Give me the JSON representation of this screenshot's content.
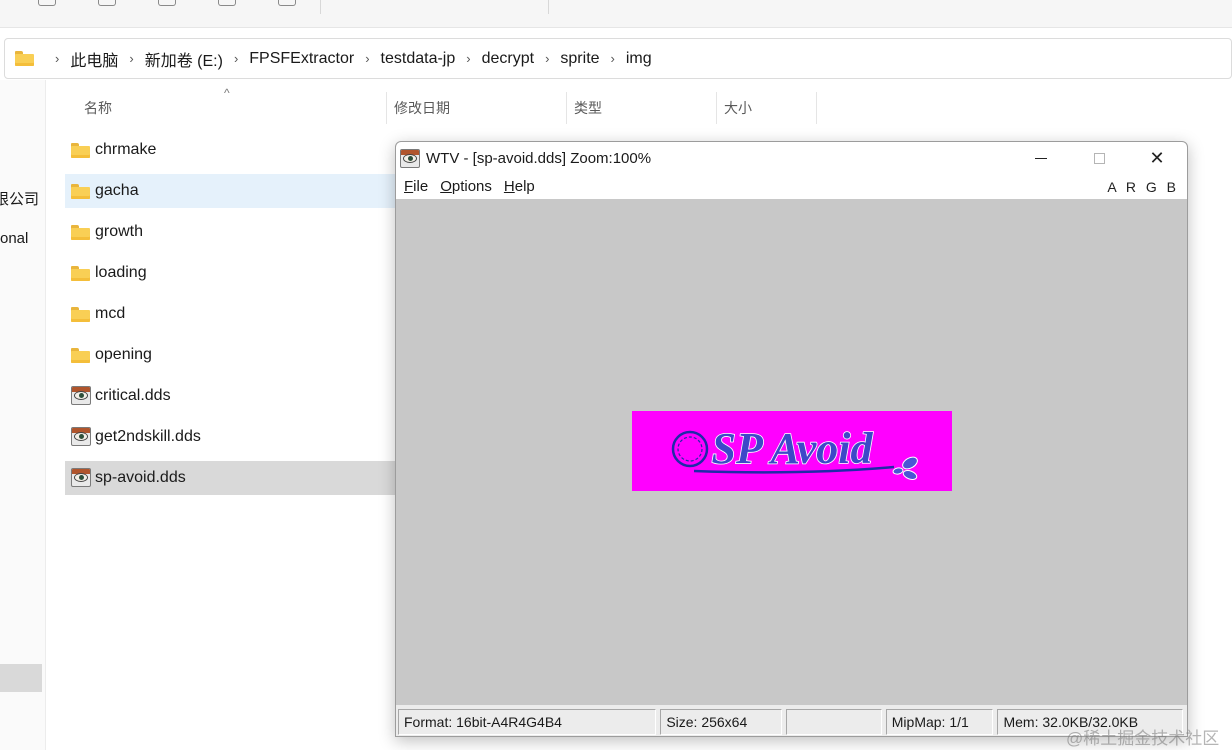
{
  "explorer": {
    "breadcrumb": [
      "此电脑",
      "新加卷 (E:)",
      "FPSFExtractor",
      "testdata-jp",
      "decrypt",
      "sprite",
      "img"
    ],
    "nav_fragments": [
      "限公司",
      "onal"
    ],
    "columns": {
      "name": "名称",
      "modified": "修改日期",
      "type": "类型",
      "size": "大小"
    },
    "files": [
      {
        "name": "chrmake",
        "kind": "folder"
      },
      {
        "name": "gacha",
        "kind": "folder"
      },
      {
        "name": "growth",
        "kind": "folder"
      },
      {
        "name": "loading",
        "kind": "folder"
      },
      {
        "name": "mcd",
        "kind": "folder"
      },
      {
        "name": "opening",
        "kind": "folder"
      },
      {
        "name": "critical.dds",
        "kind": "dds"
      },
      {
        "name": "get2ndskill.dds",
        "kind": "dds"
      },
      {
        "name": "sp-avoid.dds",
        "kind": "dds"
      }
    ]
  },
  "wtv": {
    "title": "WTV - [sp-avoid.dds] Zoom:100%",
    "menu": [
      {
        "accel": "F",
        "rest": "ile"
      },
      {
        "accel": "O",
        "rest": "ptions"
      },
      {
        "accel": "H",
        "rest": "elp"
      }
    ],
    "channels": "A R G B",
    "texture_text": "SP Avoid",
    "texture_bg": "#ff00ff",
    "status": {
      "format": "Format: 16bit-A4R4G4B4",
      "size": "Size: 256x64",
      "blank": "",
      "mipmap": "MipMap: 1/1",
      "mem": "Mem: 32.0KB/32.0KB"
    }
  },
  "watermark": "@稀土掘金技术社区"
}
